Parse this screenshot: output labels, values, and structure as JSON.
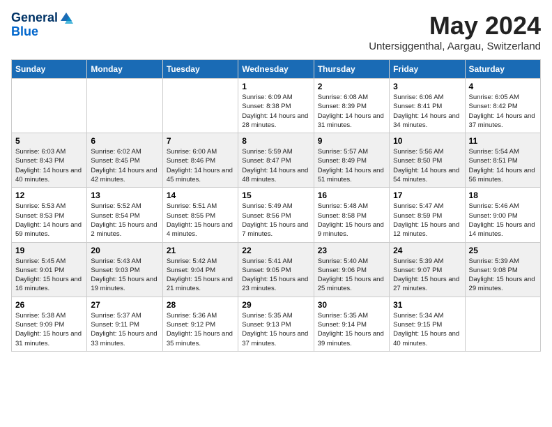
{
  "logo": {
    "general": "General",
    "blue": "Blue"
  },
  "header": {
    "title": "May 2024",
    "subtitle": "Untersiggenthal, Aargau, Switzerland"
  },
  "days_of_week": [
    "Sunday",
    "Monday",
    "Tuesday",
    "Wednesday",
    "Thursday",
    "Friday",
    "Saturday"
  ],
  "weeks": [
    [
      {
        "day": "",
        "info": ""
      },
      {
        "day": "",
        "info": ""
      },
      {
        "day": "",
        "info": ""
      },
      {
        "day": "1",
        "info": "Sunrise: 6:09 AM\nSunset: 8:38 PM\nDaylight: 14 hours\nand 28 minutes."
      },
      {
        "day": "2",
        "info": "Sunrise: 6:08 AM\nSunset: 8:39 PM\nDaylight: 14 hours\nand 31 minutes."
      },
      {
        "day": "3",
        "info": "Sunrise: 6:06 AM\nSunset: 8:41 PM\nDaylight: 14 hours\nand 34 minutes."
      },
      {
        "day": "4",
        "info": "Sunrise: 6:05 AM\nSunset: 8:42 PM\nDaylight: 14 hours\nand 37 minutes."
      }
    ],
    [
      {
        "day": "5",
        "info": "Sunrise: 6:03 AM\nSunset: 8:43 PM\nDaylight: 14 hours\nand 40 minutes."
      },
      {
        "day": "6",
        "info": "Sunrise: 6:02 AM\nSunset: 8:45 PM\nDaylight: 14 hours\nand 42 minutes."
      },
      {
        "day": "7",
        "info": "Sunrise: 6:00 AM\nSunset: 8:46 PM\nDaylight: 14 hours\nand 45 minutes."
      },
      {
        "day": "8",
        "info": "Sunrise: 5:59 AM\nSunset: 8:47 PM\nDaylight: 14 hours\nand 48 minutes."
      },
      {
        "day": "9",
        "info": "Sunrise: 5:57 AM\nSunset: 8:49 PM\nDaylight: 14 hours\nand 51 minutes."
      },
      {
        "day": "10",
        "info": "Sunrise: 5:56 AM\nSunset: 8:50 PM\nDaylight: 14 hours\nand 54 minutes."
      },
      {
        "day": "11",
        "info": "Sunrise: 5:54 AM\nSunset: 8:51 PM\nDaylight: 14 hours\nand 56 minutes."
      }
    ],
    [
      {
        "day": "12",
        "info": "Sunrise: 5:53 AM\nSunset: 8:53 PM\nDaylight: 14 hours\nand 59 minutes."
      },
      {
        "day": "13",
        "info": "Sunrise: 5:52 AM\nSunset: 8:54 PM\nDaylight: 15 hours\nand 2 minutes."
      },
      {
        "day": "14",
        "info": "Sunrise: 5:51 AM\nSunset: 8:55 PM\nDaylight: 15 hours\nand 4 minutes."
      },
      {
        "day": "15",
        "info": "Sunrise: 5:49 AM\nSunset: 8:56 PM\nDaylight: 15 hours\nand 7 minutes."
      },
      {
        "day": "16",
        "info": "Sunrise: 5:48 AM\nSunset: 8:58 PM\nDaylight: 15 hours\nand 9 minutes."
      },
      {
        "day": "17",
        "info": "Sunrise: 5:47 AM\nSunset: 8:59 PM\nDaylight: 15 hours\nand 12 minutes."
      },
      {
        "day": "18",
        "info": "Sunrise: 5:46 AM\nSunset: 9:00 PM\nDaylight: 15 hours\nand 14 minutes."
      }
    ],
    [
      {
        "day": "19",
        "info": "Sunrise: 5:45 AM\nSunset: 9:01 PM\nDaylight: 15 hours\nand 16 minutes."
      },
      {
        "day": "20",
        "info": "Sunrise: 5:43 AM\nSunset: 9:03 PM\nDaylight: 15 hours\nand 19 minutes."
      },
      {
        "day": "21",
        "info": "Sunrise: 5:42 AM\nSunset: 9:04 PM\nDaylight: 15 hours\nand 21 minutes."
      },
      {
        "day": "22",
        "info": "Sunrise: 5:41 AM\nSunset: 9:05 PM\nDaylight: 15 hours\nand 23 minutes."
      },
      {
        "day": "23",
        "info": "Sunrise: 5:40 AM\nSunset: 9:06 PM\nDaylight: 15 hours\nand 25 minutes."
      },
      {
        "day": "24",
        "info": "Sunrise: 5:39 AM\nSunset: 9:07 PM\nDaylight: 15 hours\nand 27 minutes."
      },
      {
        "day": "25",
        "info": "Sunrise: 5:39 AM\nSunset: 9:08 PM\nDaylight: 15 hours\nand 29 minutes."
      }
    ],
    [
      {
        "day": "26",
        "info": "Sunrise: 5:38 AM\nSunset: 9:09 PM\nDaylight: 15 hours\nand 31 minutes."
      },
      {
        "day": "27",
        "info": "Sunrise: 5:37 AM\nSunset: 9:11 PM\nDaylight: 15 hours\nand 33 minutes."
      },
      {
        "day": "28",
        "info": "Sunrise: 5:36 AM\nSunset: 9:12 PM\nDaylight: 15 hours\nand 35 minutes."
      },
      {
        "day": "29",
        "info": "Sunrise: 5:35 AM\nSunset: 9:13 PM\nDaylight: 15 hours\nand 37 minutes."
      },
      {
        "day": "30",
        "info": "Sunrise: 5:35 AM\nSunset: 9:14 PM\nDaylight: 15 hours\nand 39 minutes."
      },
      {
        "day": "31",
        "info": "Sunrise: 5:34 AM\nSunset: 9:15 PM\nDaylight: 15 hours\nand 40 minutes."
      },
      {
        "day": "",
        "info": ""
      }
    ]
  ]
}
